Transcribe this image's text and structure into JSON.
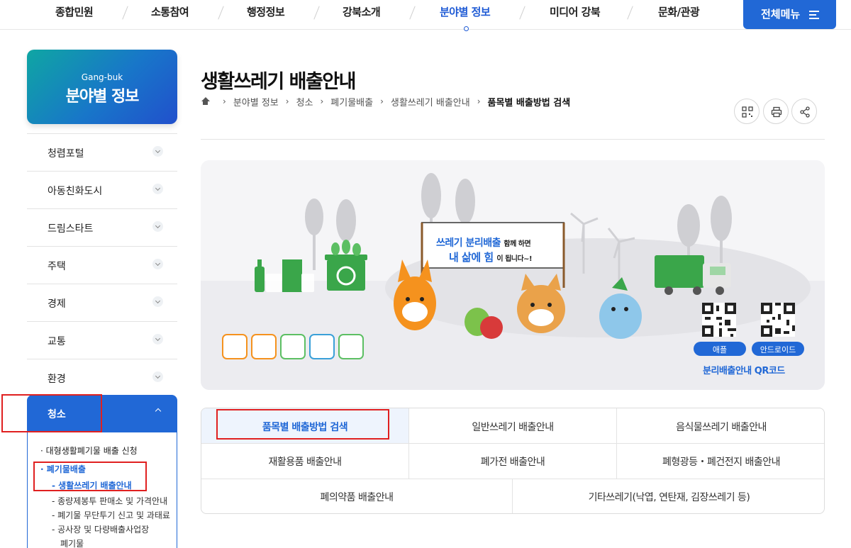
{
  "gnb": {
    "items": [
      "종합민원",
      "소통참여",
      "행정정보",
      "강북소개",
      "분야별 정보",
      "미디어 강북",
      "문화/관광"
    ],
    "active_index": 4,
    "all_menu_label": "전체메뉴"
  },
  "lnb": {
    "subtitle": "Gang-buk",
    "title": "분야별 정보",
    "items": [
      "청렴포털",
      "아동친화도시",
      "드림스타트",
      "주택",
      "경제",
      "교통",
      "환경"
    ],
    "active_label": "청소",
    "sub_items": [
      {
        "depth": 2,
        "label": "· 대형생활폐기물 배출 신청",
        "on": false
      },
      {
        "depth": 2,
        "label": "· 폐기물배출",
        "on": true
      },
      {
        "depth": 3,
        "label": "- 생활쓰레기 배출안내",
        "on": true
      },
      {
        "depth": 3,
        "label": "- 종량제봉투 판매소 및 가격안내",
        "on": false
      },
      {
        "depth": 3,
        "label": "- 폐기물 무단투기 신고 및 과태료",
        "on": false
      },
      {
        "depth": 3,
        "label": "- 공사장 및 다량배출사업장",
        "on": false
      },
      {
        "depth": 3,
        "label": "폐기물",
        "on": false
      }
    ]
  },
  "page": {
    "title": "생활쓰레기 배출안내",
    "breadcrumb": [
      "분야별 정보",
      "청소",
      "폐기물배출",
      "생활쓰레기 배출안내",
      "품목별 배출방법 검색"
    ]
  },
  "banner": {
    "sign_line1a": "쓰레기 분리배출",
    "sign_line1b": "함께 하면",
    "sign_line2a": "내 삶에 힘",
    "sign_line2b": "이 됩니다~!",
    "qr_ios_label": "애플",
    "qr_android_label": "안드로이드",
    "qr_caption": "분리배출안내 QR코드"
  },
  "tabs": [
    "품목별 배출방법 검색",
    "일반쓰레기 배출안내",
    "음식물쓰레기 배출안내",
    "재활용품 배출안내",
    "폐가전 배출안내",
    "폐형광등・폐건전지 배출안내",
    "폐의약품 배출안내",
    "기타쓰레기(낙엽, 연탄재, 김장쓰레기 등)"
  ],
  "colors": {
    "brand_blue": "#2168d6",
    "highlight_red": "#e02020",
    "eco_green": "#3aa64a"
  }
}
